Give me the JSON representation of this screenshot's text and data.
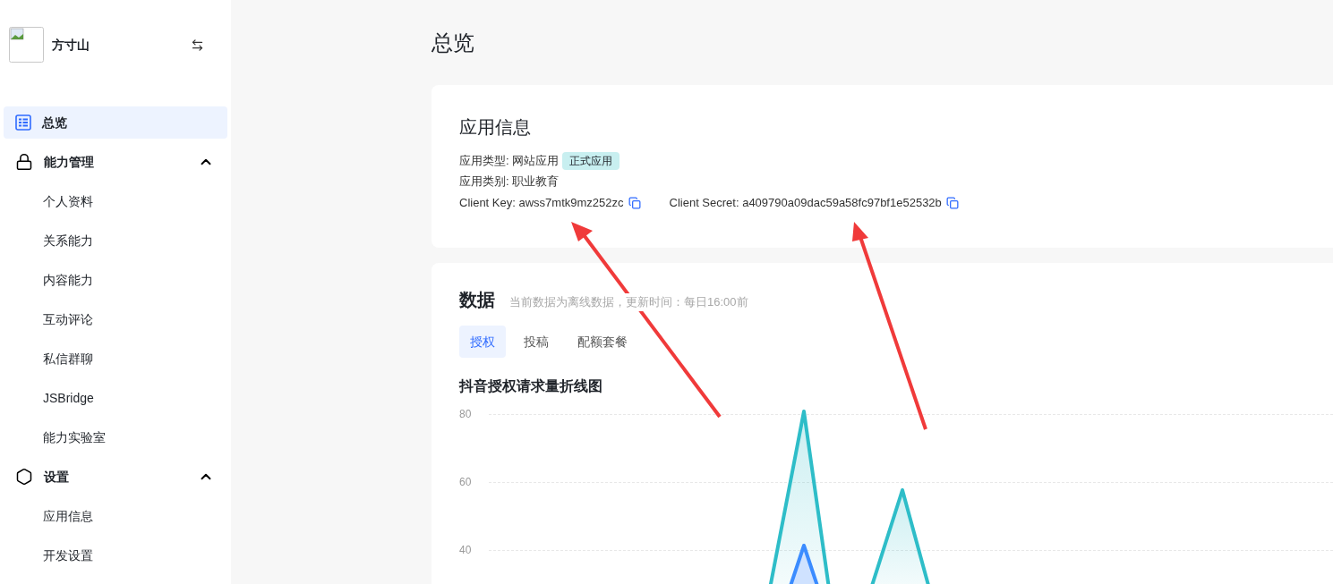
{
  "sidebar": {
    "app_name": "方寸山",
    "items": [
      {
        "label": "总览",
        "kind": "overview",
        "selected": true
      },
      {
        "label": "能力管理",
        "kind": "capability",
        "expanded": true,
        "children": [
          {
            "label": "个人资料",
            "selected": false
          },
          {
            "label": "关系能力",
            "selected": false
          },
          {
            "label": "内容能力",
            "selected": false
          },
          {
            "label": "互动评论",
            "selected": false
          },
          {
            "label": "私信群聊",
            "selected": false
          },
          {
            "label": "JSBridge",
            "selected": false
          },
          {
            "label": "能力实验室",
            "selected": false
          }
        ]
      },
      {
        "label": "设置",
        "kind": "settings",
        "expanded": true,
        "children": [
          {
            "label": "应用信息",
            "selected": false
          },
          {
            "label": "开发设置",
            "selected": false
          }
        ]
      }
    ]
  },
  "page_title": "总览",
  "app_info": {
    "title": "应用信息",
    "type_label": "应用类型: 网站应用",
    "status_tag": "正式应用",
    "category": "应用类别: 职业教育",
    "client_key": "Client Key: awss7mtk9mz252zc",
    "client_secret": "Client Secret: a409790a09dac59a58fc97bf1e52532b"
  },
  "data": {
    "title": "数据",
    "note": "当前数据为离线数据，更新时间：每日16:00前",
    "tabs": [
      {
        "label": "授权",
        "selected": true
      },
      {
        "label": "投稿",
        "selected": false
      },
      {
        "label": "配额套餐",
        "selected": false
      }
    ],
    "chart": {
      "title": "抖音授权请求量折线图",
      "y_labels": [
        "80",
        "60",
        "40"
      ]
    }
  }
}
